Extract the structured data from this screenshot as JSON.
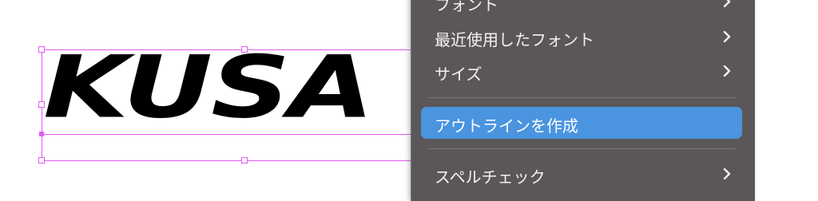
{
  "canvas": {
    "artwork_text": "KUSA"
  },
  "context_menu": {
    "items": [
      {
        "label": "フォント",
        "has_submenu": true
      },
      {
        "label": "最近使用したフォント",
        "has_submenu": true
      },
      {
        "label": "サイズ",
        "has_submenu": true
      },
      {
        "label": "アウトラインを作成",
        "has_submenu": false,
        "highlighted": true
      },
      {
        "label": "スペルチェック",
        "has_submenu": true
      }
    ]
  },
  "colors": {
    "selection": "#e25cf2",
    "menu_background": "#5b5759",
    "menu_highlight": "#4a94e0",
    "menu_text": "#f2f1f2"
  },
  "icons": {
    "submenu": "chevron-right-icon"
  }
}
